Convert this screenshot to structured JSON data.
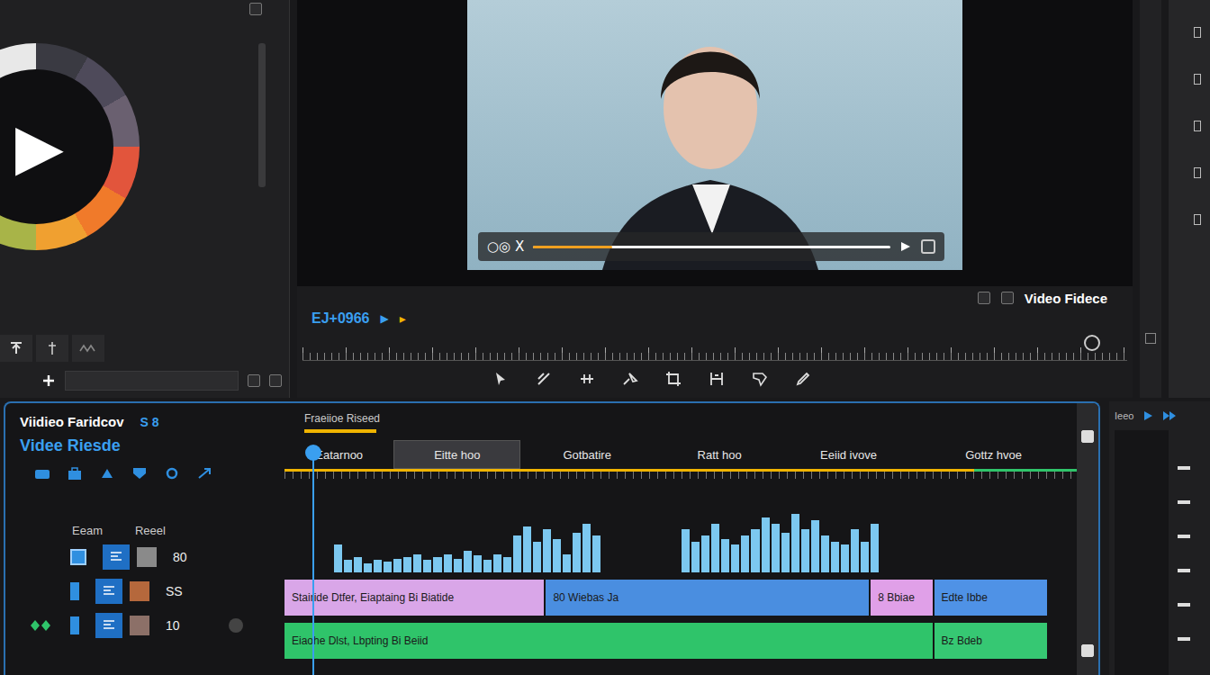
{
  "source_panel": {
    "play": "▶",
    "wheel": [
      "#3a3a42",
      "#4e4a5a",
      "#6a6070",
      "#e2553c",
      "#f07a2a",
      "#f0a030",
      "#a8b448",
      "#5f9a4e",
      "#3f7a48",
      "#2f4a38",
      "#2a2a2e",
      "#e8e8e8"
    ]
  },
  "viewer": {
    "overlay": {
      "label": "○◎ X",
      "level": 0.22
    },
    "title": "Video Fidece",
    "timecode": "EJ+0966",
    "play": "▶",
    "marker": "▸"
  },
  "timeline": {
    "title": "Viidieo Faridcov",
    "badge": "S 8",
    "subtitle": "Videe Riesde",
    "columns": [
      "Eeam",
      "Reeel"
    ],
    "tracks": [
      {
        "value": "80",
        "swatch": "#8a8a8a",
        "selected": true,
        "record": false,
        "keyframe": false
      },
      {
        "value": "SS",
        "swatch": "#b5683c",
        "selected": false,
        "record": false,
        "keyframe": false
      },
      {
        "value": "10",
        "swatch": "#8c7068",
        "selected": false,
        "record": true,
        "keyframe": true
      }
    ],
    "sequence_label": "Fraeiioe Riseed",
    "markers": [
      {
        "label": "Eatarnoo",
        "share": 0.138,
        "selected": false
      },
      {
        "label": "Eitte hoo",
        "share": 0.16,
        "selected": true
      },
      {
        "label": "Gotbatire",
        "share": 0.168,
        "selected": false
      },
      {
        "label": "Ratt hoo",
        "share": 0.166,
        "selected": false
      },
      {
        "label": "Eeiid ivove",
        "share": 0.16,
        "selected": false
      },
      {
        "label": "Gottz hvoe",
        "share": 0.206,
        "selected": false
      }
    ],
    "render_level": 0.87,
    "playhead_level": 0.035,
    "audio": [
      0,
      0,
      0,
      0,
      0,
      0.45,
      0.2,
      0.25,
      0.15,
      0.2,
      0.18,
      0.22,
      0.25,
      0.3,
      0.2,
      0.25,
      0.3,
      0.22,
      0.35,
      0.28,
      0.2,
      0.3,
      0.25,
      0.6,
      0.75,
      0.5,
      0.7,
      0.55,
      0.3,
      0.65,
      0.8,
      0.6,
      0,
      0,
      0,
      0,
      0,
      0,
      0,
      0,
      0.7,
      0.5,
      0.6,
      0.8,
      0.55,
      0.45,
      0.6,
      0.7,
      0.9,
      0.8,
      0.65,
      0.95,
      0.7,
      0.85,
      0.6,
      0.5,
      0.45,
      0.7,
      0.5,
      0.8,
      0,
      0,
      0,
      0,
      0,
      0,
      0,
      0,
      0,
      0,
      0,
      0,
      0,
      0,
      0,
      0,
      0,
      0,
      0,
      0
    ],
    "rows": [
      {
        "clips": [
          {
            "label": "Stairide Dtfer, Eiaptaing  Bi Biatide",
            "color": "#d9a6e8",
            "share": 0.33
          },
          {
            "label": "80 Wiebas Ja",
            "color": "#4a8ee0",
            "share": 0.41
          },
          {
            "label": "8 Bbiae",
            "color": "#e0a0e8",
            "share": 0.08
          },
          {
            "label": "Edte Ibbe",
            "color": "#4f92e6",
            "share": 0.145
          }
        ]
      },
      {
        "clips": [
          {
            "label": "Eiaohe Dlst, Lbpting  Bi Beiid",
            "color": "#2fc46a",
            "share": 0.82
          },
          {
            "label": "Bz Bdeb",
            "color": "#36c873",
            "share": 0.145
          }
        ]
      }
    ]
  },
  "side_panel": {
    "label": "Ieeo"
  }
}
